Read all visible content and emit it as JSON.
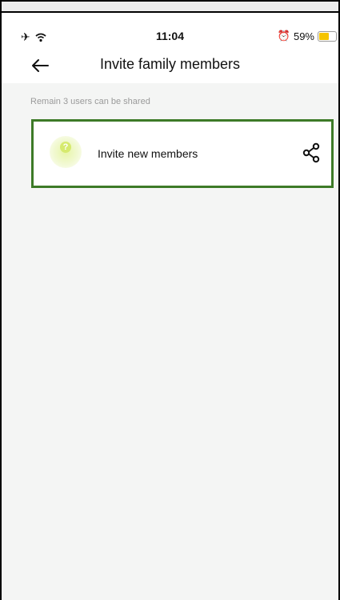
{
  "status_bar": {
    "time": "11:04",
    "battery_percent": "59%",
    "battery_level": 0.59,
    "battery_color": "#f5c400",
    "icons": [
      "airplane-icon",
      "wifi-icon",
      "alarm-icon",
      "battery-icon"
    ]
  },
  "header": {
    "title": "Invite family members",
    "back_icon": "back-arrow-icon"
  },
  "hint_text": "Remain 3 users can be shared",
  "invite_card": {
    "label": "Invite new members",
    "avatar_icon": "question-mark-icon",
    "action_icon": "share-icon",
    "border_color": "#3d7a27"
  }
}
